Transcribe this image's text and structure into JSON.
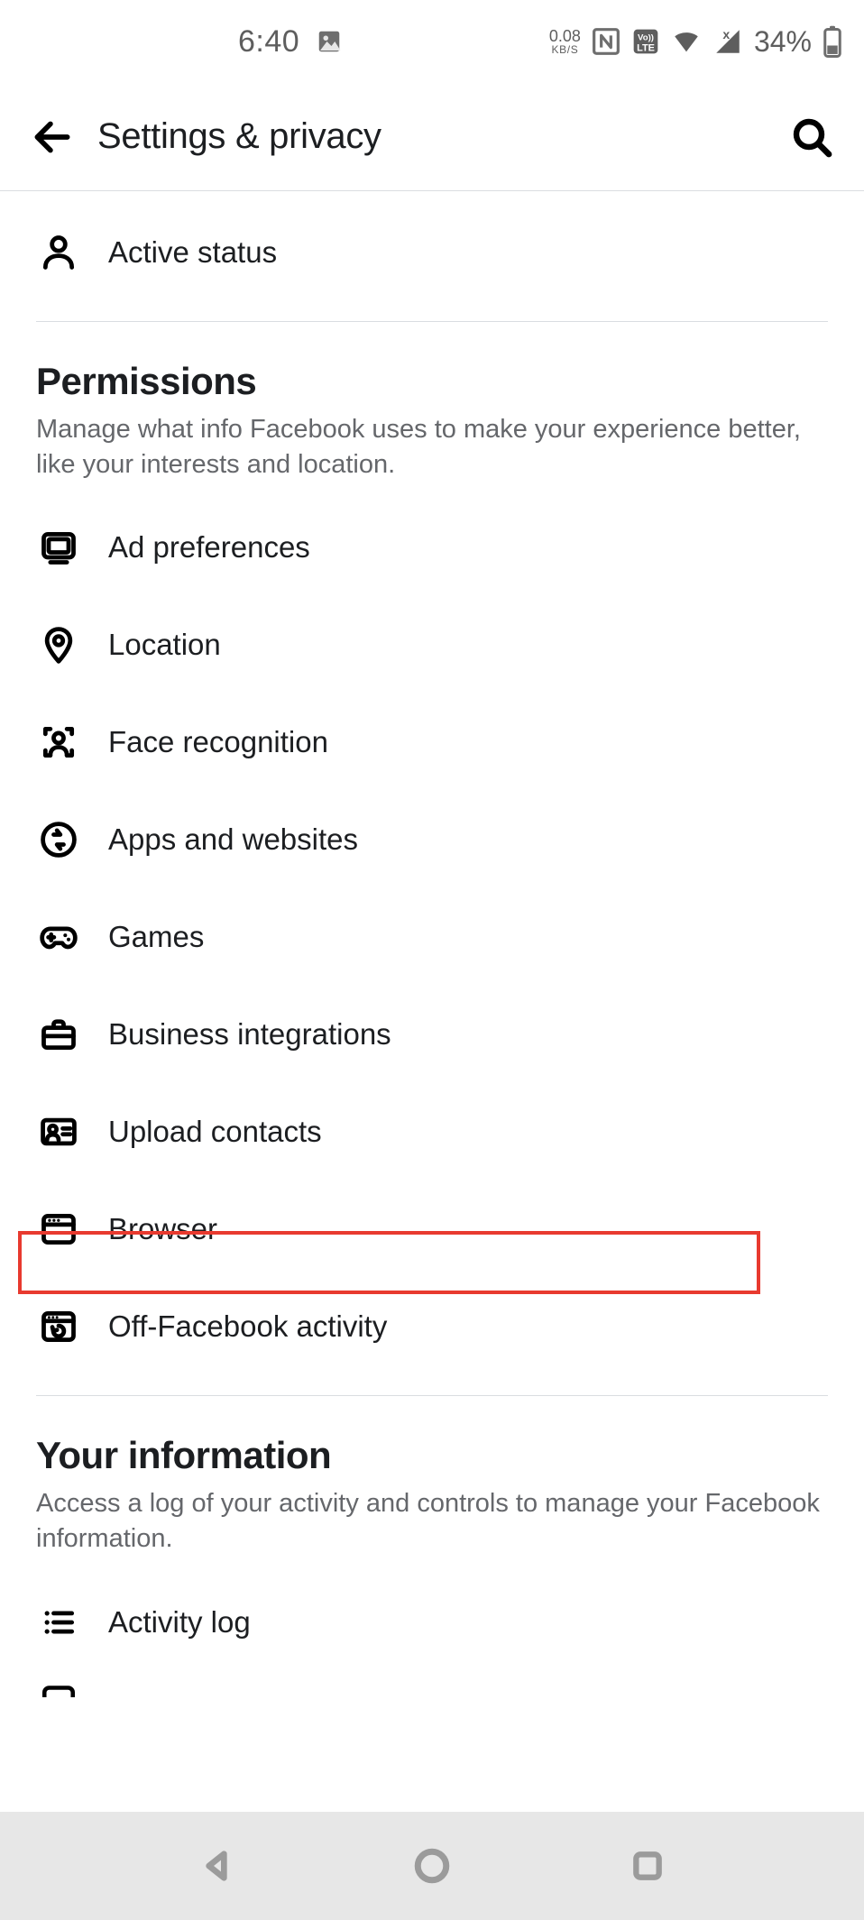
{
  "status_bar": {
    "time": "6:40",
    "net_speed_value": "0.08",
    "net_speed_unit": "KB/S",
    "battery_percent": "34%"
  },
  "header": {
    "title": "Settings & privacy"
  },
  "top_items": {
    "active_status": "Active status"
  },
  "sections": {
    "permissions": {
      "title": "Permissions",
      "subtitle": "Manage what info Facebook uses to make your experience better, like your interests and location.",
      "items": {
        "ad_prefs": "Ad preferences",
        "location": "Location",
        "face_recog": "Face recognition",
        "apps_web": "Apps and websites",
        "games": "Games",
        "biz_int": "Business integrations",
        "upload_contacts": "Upload contacts",
        "browser": "Browser",
        "off_fb": "Off-Facebook activity"
      }
    },
    "your_info": {
      "title": "Your information",
      "subtitle": "Access a log of your activity and controls to manage your Facebook information.",
      "items": {
        "activity_log": "Activity log"
      }
    }
  }
}
